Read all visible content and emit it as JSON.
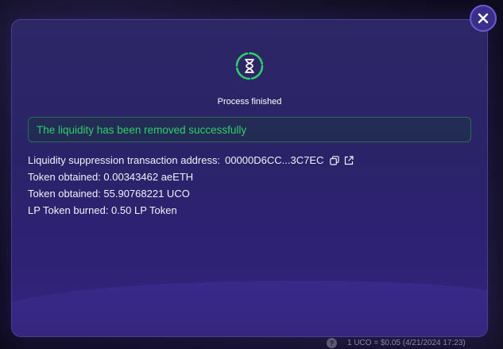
{
  "modal": {
    "status_text": "Process finished",
    "status_icon": "hourglass-icon",
    "success_message": "The liquidity has been removed successfully",
    "details": {
      "tx_label": "Liquidity suppression transaction address:",
      "tx_address": "00000D6CC...3C7EC",
      "token1": "Token obtained: 0.00343462 aeETH",
      "token2": "Token obtained: 55.90768221 UCO",
      "lp_burned": "LP Token burned: 0.50 LP Token"
    }
  },
  "footer": {
    "help_glyph": "?",
    "price_text": "1 UCO = $0.05 (4/21/2024 17:23)"
  },
  "colors": {
    "success": "#2fcf6b",
    "accent": "#6b5cd6",
    "modal_bg": "#2a2368"
  },
  "icons": {
    "close": "close-icon",
    "copy": "copy-icon",
    "external_link": "external-link-icon"
  }
}
